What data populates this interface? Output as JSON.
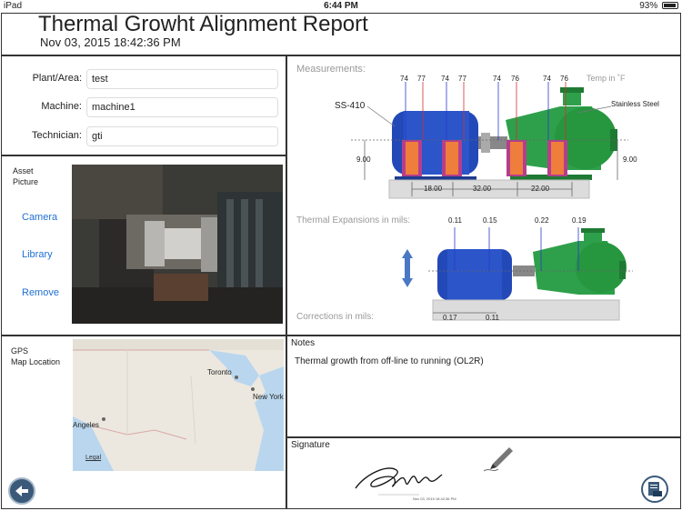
{
  "status": {
    "device": "iPad",
    "time": "6:44 PM",
    "battery": "93%"
  },
  "header": {
    "title": "Thermal Growht Alignment Report",
    "date": "Nov 03, 2015  18:42:36 PM"
  },
  "form": {
    "plant_label": "Plant/Area:",
    "plant_value": "test",
    "machine_label": "Machine:",
    "machine_value": "machine1",
    "tech_label": "Technician:",
    "tech_value": "gti"
  },
  "asset": {
    "label1": "Asset",
    "label2": "Picture",
    "camera": "Camera",
    "library": "Library",
    "remove": "Remove"
  },
  "gps": {
    "label1": "GPS",
    "label2": "Map Location",
    "cities": {
      "toronto": "Toronto",
      "newyork": "New York",
      "angeles": "Angeles"
    },
    "legal": "Legal"
  },
  "measurements": {
    "title": "Measurements:",
    "temp_unit": "Temp in ˚F",
    "ss410": "SS-410",
    "stainless": "Stainless Steel",
    "temps": [
      "74",
      "77",
      "74",
      "77",
      "74",
      "76",
      "74",
      "76"
    ],
    "height_left": "9.00",
    "height_right": "9.00",
    "spacings": [
      "18.00",
      "32.00",
      "22.00"
    ],
    "expansions_title": "Thermal Expansions in mils:",
    "expansions": [
      "0.11",
      "0.15",
      "0.22",
      "0.19"
    ],
    "corrections_title": "Corrections in mils:",
    "corrections": [
      "0.17",
      "0.11"
    ]
  },
  "notes": {
    "title": "Notes",
    "text": "Thermal growth from off-line to running (OL2R)"
  },
  "signature": {
    "title": "Signature",
    "stamp": "Nov 03, 2015 18:42:36 PM"
  },
  "colors": {
    "link": "#1f6fd1",
    "motor": "#1f3fbf",
    "pump": "#2ea04b"
  }
}
